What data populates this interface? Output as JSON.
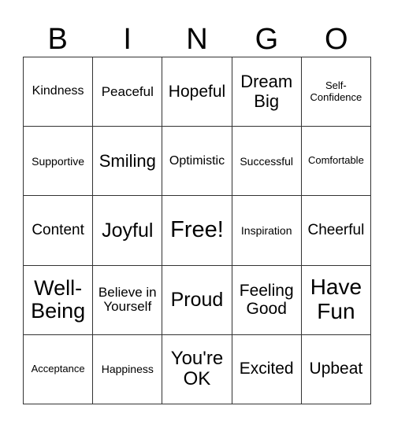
{
  "header": {
    "letters": [
      "B",
      "I",
      "N",
      "G",
      "O"
    ]
  },
  "board": {
    "rows": [
      [
        "Kindness",
        "Peaceful",
        "Hopeful",
        "Dream Big",
        "Self-Confidence"
      ],
      [
        "Supportive",
        "Smiling",
        "Optimistic",
        "Successful",
        "Comfortable"
      ],
      [
        "Content",
        "Joyful",
        "Free!",
        "Inspiration",
        "Cheerful"
      ],
      [
        "Well-Being",
        "Believe in Yourself",
        "Proud",
        "Feeling Good",
        "Have Fun"
      ],
      [
        "Acceptance",
        "Happiness",
        "You're OK",
        "Excited",
        "Upbeat"
      ]
    ]
  }
}
